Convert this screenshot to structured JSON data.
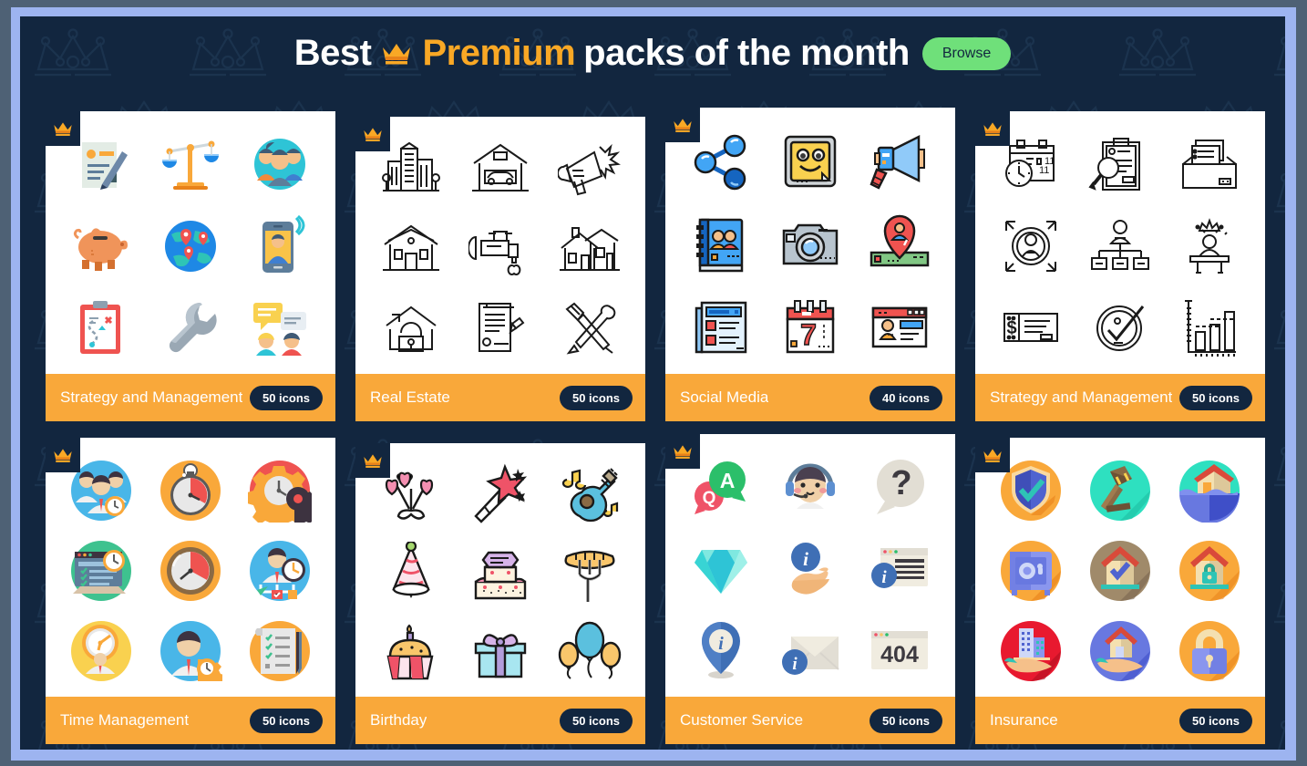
{
  "header": {
    "title_before": "Best",
    "title_highlight": "Premium",
    "title_after": "packs of the month",
    "crown_icon": "crown-icon",
    "browse_label": "Browse"
  },
  "colors": {
    "background": "#12263f",
    "frame": "#9db4f0",
    "outer": "#4e6175",
    "accent_orange": "#f9a83a",
    "title_highlight": "#f9a825",
    "browse_green": "#6fe07a",
    "badge_dark": "#12263f",
    "card_bg": "#ffffff"
  },
  "cards": [
    {
      "title": "Strategy and Management",
      "count_label": "50 icons",
      "premium": true,
      "style": "flat-color",
      "icons": [
        "document-pen-icon",
        "scales-balance-icon",
        "team-group-icon",
        "piggy-bank-icon",
        "globe-pins-icon",
        "mobile-user-icon",
        "clipboard-route-icon",
        "wrench-icon",
        "chat-people-icon"
      ]
    },
    {
      "title": "Real Estate",
      "count_label": "50 icons",
      "premium": true,
      "style": "line-art",
      "icons": [
        "office-building-icon",
        "garage-car-icon",
        "megaphone-icon",
        "house-icon",
        "faucet-drip-icon",
        "suburban-house-icon",
        "house-lock-icon",
        "contract-pen-icon",
        "hammer-screwdriver-icon"
      ]
    },
    {
      "title": "Social Media",
      "count_label": "40 icons",
      "premium": true,
      "style": "filled-outline",
      "icons": [
        "share-nodes-icon",
        "smiley-sticker-icon",
        "megaphone-blue-icon",
        "contacts-book-icon",
        "camera-icon",
        "location-pin-user-icon",
        "news-article-icon",
        "calendar-seven-icon",
        "profile-page-icon"
      ]
    },
    {
      "title": "Strategy and Management",
      "count_label": "50 icons",
      "premium": true,
      "style": "line-art",
      "icons": [
        "calendar-clock-icon",
        "clipboard-search-icon",
        "file-tray-icon",
        "target-person-icon",
        "org-chart-icon",
        "leader-podium-icon",
        "cheque-dollar-icon",
        "check-circle-icon",
        "bar-chart-icon"
      ]
    },
    {
      "title": "Time Management",
      "count_label": "50 icons",
      "premium": true,
      "style": "flat-circle",
      "icons": [
        "team-clock-icon",
        "stopwatch-icon",
        "gear-clock-icon",
        "browser-clock-icon",
        "timer-dial-icon",
        "person-schedule-icon",
        "speed-clock-icon",
        "manager-gear-icon",
        "checklist-pen-icon"
      ]
    },
    {
      "title": "Birthday",
      "count_label": "50 icons",
      "premium": true,
      "style": "filled-outline",
      "icons": [
        "flower-bouquet-icon",
        "magic-wand-icon",
        "guitar-music-icon",
        "party-hat-icon",
        "birthday-cake-icon",
        "sausage-fork-icon",
        "cupcake-candle-icon",
        "gift-box-icon",
        "balloons-icon"
      ]
    },
    {
      "title": "Customer Service",
      "count_label": "50 icons",
      "premium": true,
      "style": "flat-color",
      "icons": [
        "qa-bubbles-icon",
        "headset-agent-icon",
        "question-bubble-icon",
        "diamond-icon",
        "info-hand-icon",
        "info-window-icon",
        "info-pin-icon",
        "info-envelope-icon",
        "error-404-icon"
      ]
    },
    {
      "title": "Insurance",
      "count_label": "50 icons",
      "premium": true,
      "style": "flat-circle",
      "icons": [
        "shield-check-icon",
        "gavel-icon",
        "flood-house-icon",
        "safe-vault-icon",
        "house-check-icon",
        "house-lock-circle-icon",
        "building-hand-icon",
        "house-hand-icon",
        "padlock-icon"
      ]
    }
  ]
}
